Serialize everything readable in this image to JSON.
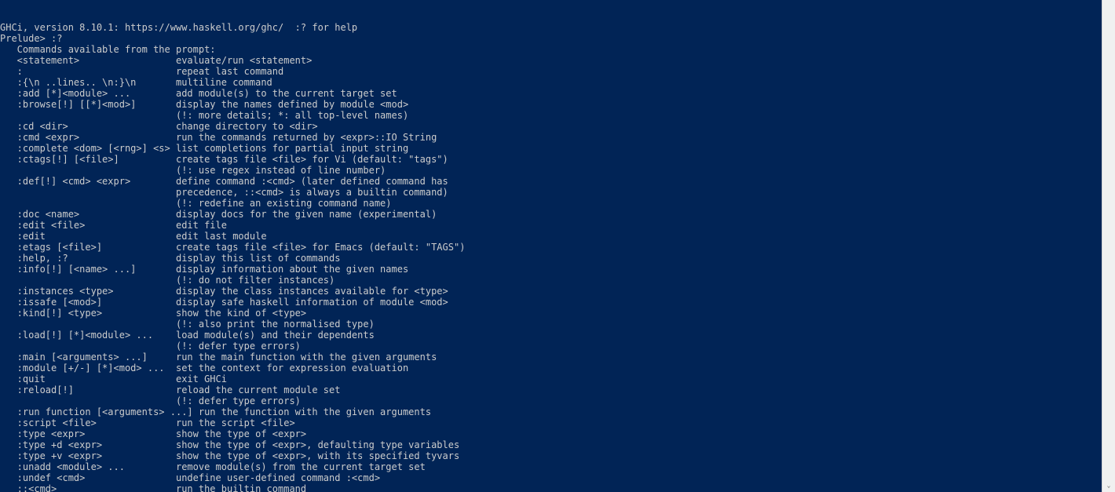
{
  "header_line": "GHCi, version 8.10.1: https://www.haskell.org/ghc/  :? for help",
  "prompt": "Prelude> ",
  "command_typed": ":?",
  "intro": "   Commands available from the prompt:",
  "blank": "",
  "help": [
    {
      "cmd": "   <statement>               ",
      "desc": "  evaluate/run <statement>"
    },
    {
      "cmd": "   :                         ",
      "desc": "  repeat last command"
    },
    {
      "cmd": "   :{\\n ..lines.. \\n:}\\n     ",
      "desc": "  multiline command"
    },
    {
      "cmd": "   :add [*]<module> ...      ",
      "desc": "  add module(s) to the current target set"
    },
    {
      "cmd": "   :browse[!] [[*]<mod>]     ",
      "desc": "  display the names defined by module <mod>"
    },
    {
      "cmd": "                             ",
      "desc": "  (!: more details; *: all top-level names)"
    },
    {
      "cmd": "   :cd <dir>                 ",
      "desc": "  change directory to <dir>"
    },
    {
      "cmd": "   :cmd <expr>               ",
      "desc": "  run the commands returned by <expr>::IO String"
    },
    {
      "cmd": "   :complete <dom> [<rng>] <s>",
      "desc": " list completions for partial input string"
    },
    {
      "cmd": "   :ctags[!] [<file>]        ",
      "desc": "  create tags file <file> for Vi (default: \"tags\")"
    },
    {
      "cmd": "                             ",
      "desc": "  (!: use regex instead of line number)"
    },
    {
      "cmd": "   :def[!] <cmd> <expr>      ",
      "desc": "  define command :<cmd> (later defined command has"
    },
    {
      "cmd": "                             ",
      "desc": "  precedence, ::<cmd> is always a builtin command)"
    },
    {
      "cmd": "                             ",
      "desc": "  (!: redefine an existing command name)"
    },
    {
      "cmd": "   :doc <name>               ",
      "desc": "  display docs for the given name (experimental)"
    },
    {
      "cmd": "   :edit <file>              ",
      "desc": "  edit file"
    },
    {
      "cmd": "   :edit                     ",
      "desc": "  edit last module"
    },
    {
      "cmd": "   :etags [<file>]           ",
      "desc": "  create tags file <file> for Emacs (default: \"TAGS\")"
    },
    {
      "cmd": "   :help, :?                 ",
      "desc": "  display this list of commands"
    },
    {
      "cmd": "   :info[!] [<name> ...]     ",
      "desc": "  display information about the given names"
    },
    {
      "cmd": "                             ",
      "desc": "  (!: do not filter instances)"
    },
    {
      "cmd": "   :instances <type>         ",
      "desc": "  display the class instances available for <type>"
    },
    {
      "cmd": "   :issafe [<mod>]           ",
      "desc": "  display safe haskell information of module <mod>"
    },
    {
      "cmd": "   :kind[!] <type>           ",
      "desc": "  show the kind of <type>"
    },
    {
      "cmd": "                             ",
      "desc": "  (!: also print the normalised type)"
    },
    {
      "cmd": "   :load[!] [*]<module> ...  ",
      "desc": "  load module(s) and their dependents"
    },
    {
      "cmd": "                             ",
      "desc": "  (!: defer type errors)"
    },
    {
      "cmd": "   :main [<arguments> ...]   ",
      "desc": "  run the main function with the given arguments"
    },
    {
      "cmd": "   :module [+/-] [*]<mod> ...",
      "desc": "  set the context for expression evaluation"
    },
    {
      "cmd": "   :quit                     ",
      "desc": "  exit GHCi"
    },
    {
      "cmd": "   :reload[!]                ",
      "desc": "  reload the current module set"
    },
    {
      "cmd": "                             ",
      "desc": "  (!: defer type errors)"
    },
    {
      "cmd": "   :run function [<arguments> ...]",
      "desc": " run the function with the given arguments"
    },
    {
      "cmd": "   :script <file>            ",
      "desc": "  run the script <file>"
    },
    {
      "cmd": "   :type <expr>              ",
      "desc": "  show the type of <expr>"
    },
    {
      "cmd": "   :type +d <expr>           ",
      "desc": "  show the type of <expr>, defaulting type variables"
    },
    {
      "cmd": "   :type +v <expr>           ",
      "desc": "  show the type of <expr>, with its specified tyvars"
    },
    {
      "cmd": "   :unadd <module> ...       ",
      "desc": "  remove module(s) from the current target set"
    },
    {
      "cmd": "   :undef <cmd>              ",
      "desc": "  undefine user-defined command :<cmd>"
    },
    {
      "cmd": "   ::<cmd>                   ",
      "desc": "  run the builtin command"
    }
  ],
  "scrollbar": {
    "down_arrow": "⌄"
  }
}
